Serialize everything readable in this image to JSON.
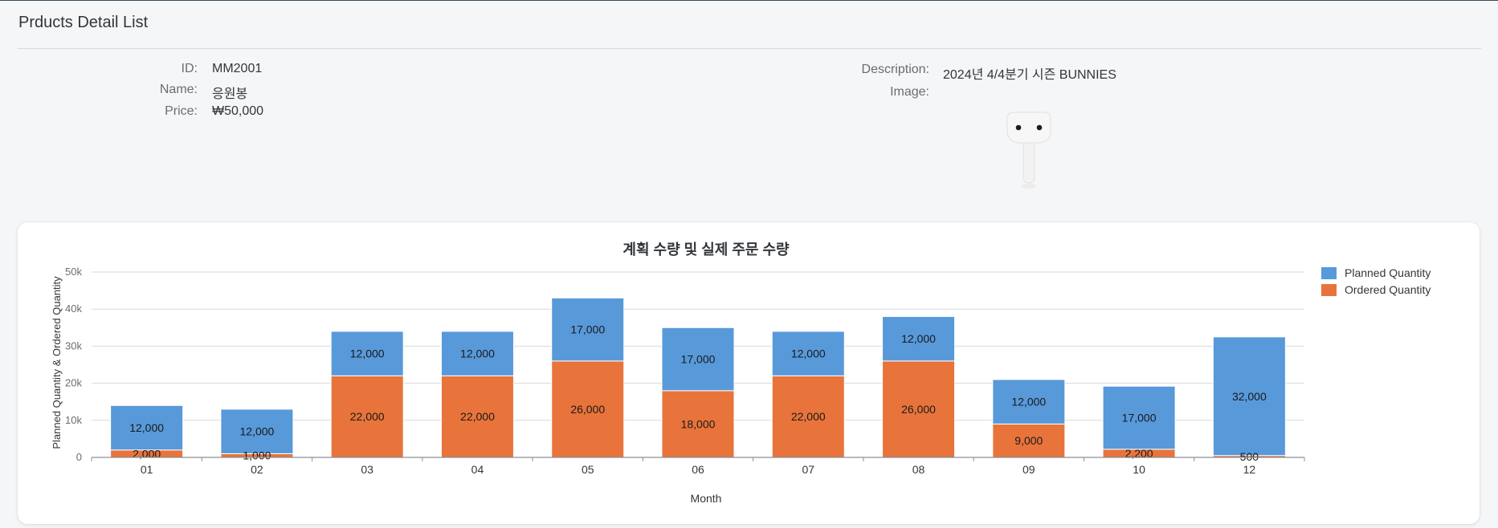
{
  "page": {
    "title": "Prducts Detail List"
  },
  "product": {
    "id_label": "ID:",
    "id_value": "MM2001",
    "name_label": "Name:",
    "name_value": "응원봉",
    "price_label": "Price:",
    "price_value": "₩50,000",
    "description_label": "Description:",
    "description_value": "2024년 4/4분기 시즌 BUNNIES",
    "image_label": "Image:"
  },
  "colors": {
    "planned": "#5899da",
    "ordered": "#e8743b",
    "grid": "#d9d9d9",
    "axis": "#89919a"
  },
  "chart_data": {
    "type": "bar",
    "stacked": true,
    "title": "계획 수량 및 실제 주문 수량",
    "xlabel": "Month",
    "ylabel": "Planned Quantity & Ordered Quantity",
    "ylim": [
      0,
      50000
    ],
    "yticks": [
      "0",
      "10k",
      "20k",
      "30k",
      "40k",
      "50k"
    ],
    "grid": true,
    "legend_position": "right",
    "categories": [
      "01",
      "02",
      "03",
      "04",
      "05",
      "06",
      "07",
      "08",
      "09",
      "10",
      "12"
    ],
    "series": [
      {
        "name": "Ordered Quantity",
        "values": [
          2000,
          1000,
          22000,
          22000,
          26000,
          18000,
          22000,
          26000,
          9000,
          2200,
          500
        ],
        "labels": [
          "2,000",
          "1,000",
          "22,000",
          "22,000",
          "26,000",
          "18,000",
          "22,000",
          "26,000",
          "9,000",
          "2,200",
          "500"
        ]
      },
      {
        "name": "Planned Quantity",
        "values": [
          12000,
          12000,
          12000,
          12000,
          17000,
          17000,
          12000,
          12000,
          12000,
          17000,
          32000
        ],
        "labels": [
          "12,000",
          "12,000",
          "12,000",
          "12,000",
          "17,000",
          "17,000",
          "12,000",
          "12,000",
          "12,000",
          "17,000",
          "32,000"
        ]
      }
    ],
    "legend": [
      "Planned Quantity",
      "Ordered Quantity"
    ]
  }
}
